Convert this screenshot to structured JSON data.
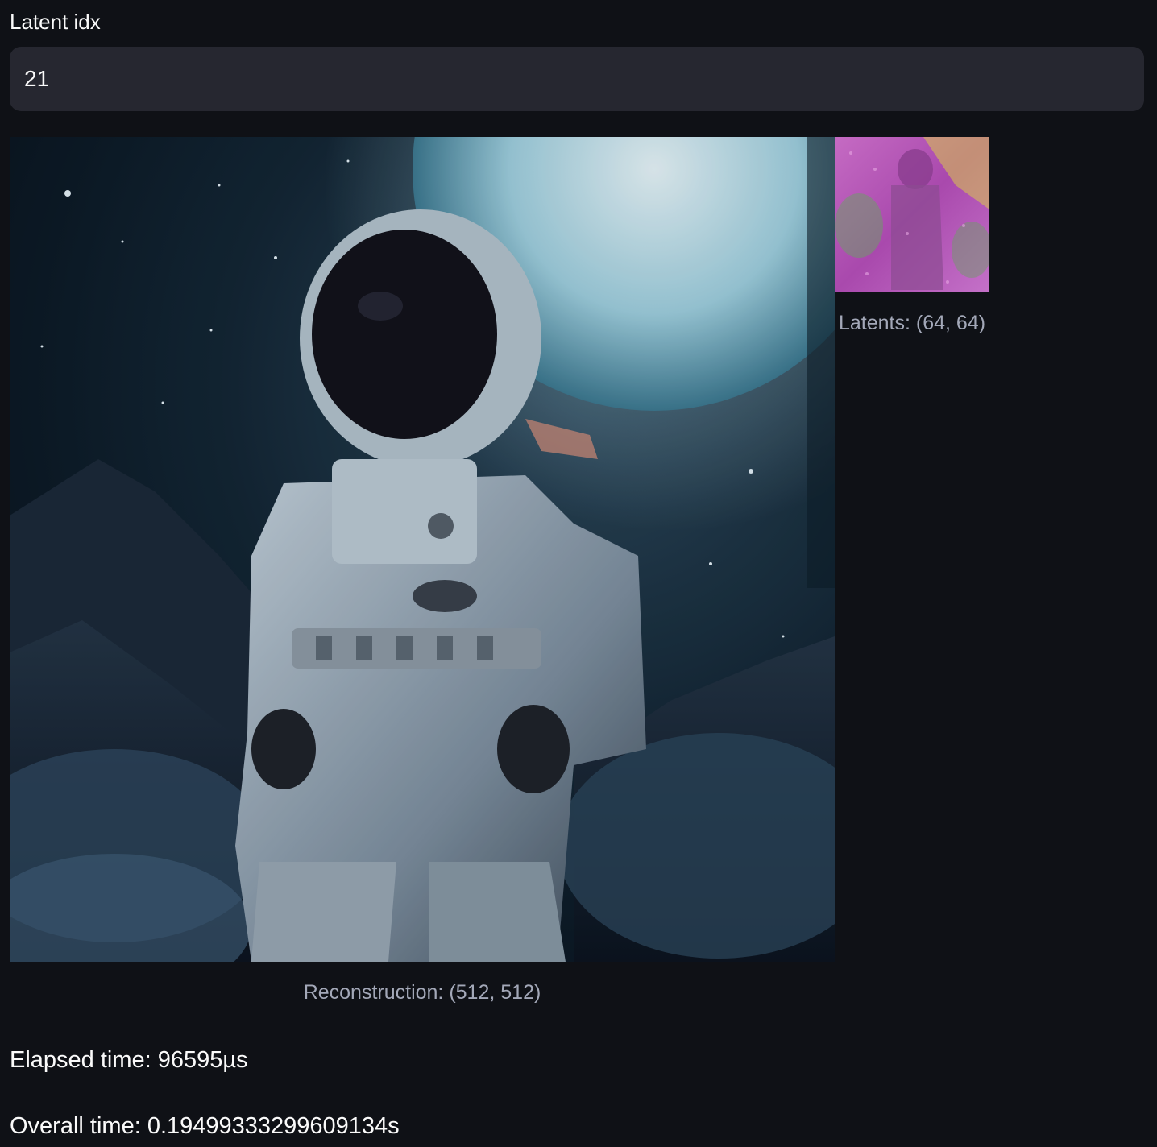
{
  "latent_input": {
    "label": "Latent idx",
    "value": "21"
  },
  "images": {
    "reconstruction": {
      "subject": "astronaut standing on rocky alien terrain with large glowing planet in night sky",
      "caption": "Reconstruction: (512, 512)"
    },
    "latents": {
      "subject": "noisy magenta/green latent visualization of astronaut",
      "caption": "Latents: (64, 64)"
    }
  },
  "stats": {
    "elapsed": "Elapsed time: 96595µs",
    "overall": "Overall time: 0.19499333299609134s"
  },
  "colors": {
    "background": "#0f1116",
    "input_bg": "#262730",
    "caption": "#a3a8b8",
    "text": "#fafafa"
  }
}
